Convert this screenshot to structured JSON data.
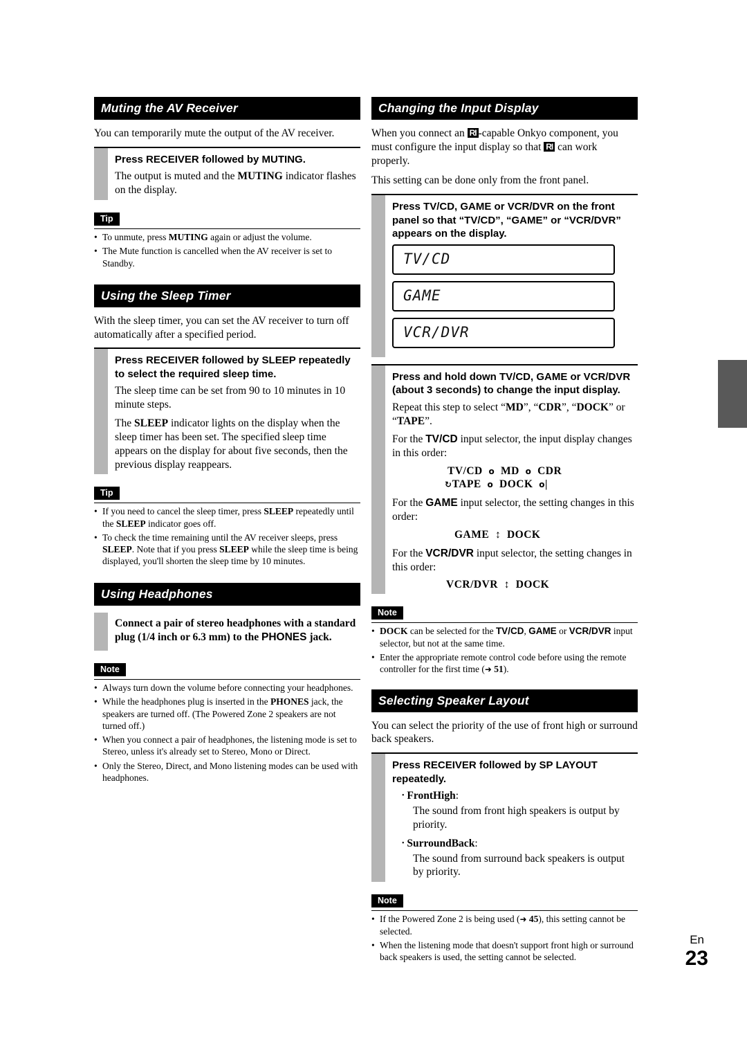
{
  "page": {
    "footer_lang": "En",
    "footer_number": "23"
  },
  "left": {
    "muting": {
      "heading": "Muting the AV Receiver",
      "intro": "You can temporarily mute the output of the AV receiver.",
      "step_title": "Press RECEIVER followed by MUTING.",
      "step_body": "The output is muted and the MUTING indicator flashes on the display.",
      "tip_label": "Tip",
      "tips": [
        "To unmute, press MUTING again or adjust the volume.",
        "The Mute function is cancelled when the AV receiver is set to Standby."
      ]
    },
    "sleep": {
      "heading": "Using the Sleep Timer",
      "intro": "With the sleep timer, you can set the AV receiver to turn off automatically after a specified period.",
      "step_title": "Press RECEIVER followed by SLEEP repeatedly to select the required sleep time.",
      "step_body_1": "The sleep time can be set from 90 to 10 minutes in 10 minute steps.",
      "step_body_2": "The SLEEP indicator lights on the display when the sleep timer has been set. The specified sleep time appears on the display for about five seconds, then the previous display reappears.",
      "tip_label": "Tip",
      "tips": [
        "If you need to cancel the sleep timer, press SLEEP repeatedly until the SLEEP indicator goes off.",
        "To check the time remaining until the AV receiver sleeps, press SLEEP. Note that if you press SLEEP while the sleep time is being displayed, you'll shorten the sleep time by 10 minutes."
      ]
    },
    "headphones": {
      "heading": "Using Headphones",
      "step_title": "Connect a pair of stereo headphones with a standard plug (1/4 inch or 6.3 mm) to the PHONES jack.",
      "note_label": "Note",
      "notes": [
        "Always turn down the volume before connecting your headphones.",
        "While the headphones plug is inserted in the PHONES jack, the speakers are turned off. (The Powered Zone 2 speakers are not turned off.)",
        "When you connect a pair of headphones, the listening mode is set to Stereo, unless it's already set to Stereo, Mono or Direct.",
        "Only the Stereo, Direct, and Mono listening modes can be used with headphones."
      ]
    }
  },
  "right": {
    "input_display": {
      "heading": "Changing the Input Display",
      "intro_1": "When you connect an RI-capable Onkyo component, you must configure the input display so that RI can work properly.",
      "intro_2": "This setting can be done only from the front panel.",
      "step1_title": "Press TV/CD, GAME or VCR/DVR on the front panel so that “TV/CD”, “GAME” or “VCR/DVR” appears on the display.",
      "panels": [
        "TV/CD",
        "GAME",
        "VCR/DVR"
      ],
      "step2_title": "Press and hold down TV/CD, GAME or VCR/DVR (about 3 seconds) to change the input display.",
      "step2_body_1": "Repeat this step to select “MD”, “CDR”, “DOCK” or “TAPE”.",
      "step2_body_2": "For the TV/CD input selector, the input display changes in this order:",
      "seq_tvcd_line1": "TV/CD      MD      CDR",
      "seq_tvcd_line2": "TAPE      DOCK",
      "step2_body_3": "For the GAME input selector, the setting changes in this order:",
      "seq_game": "GAME     DOCK",
      "step2_body_4": "For the VCR/DVR input selector, the setting changes in this order:",
      "seq_vcr": "VCR/DVR     DOCK",
      "note_label": "Note",
      "notes": [
        "DOCK can be selected for the TV/CD, GAME or VCR/DVR input selector, but not at the same time.",
        "Enter the appropriate remote control code before using the remote controller for the first time (→ 51)."
      ]
    },
    "speaker_layout": {
      "heading": "Selecting Speaker Layout",
      "intro": "You can select the priority of the use of front high or surround back speakers.",
      "step_title": "Press RECEIVER followed by SP LAYOUT repeatedly.",
      "option1_label": "FrontHigh",
      "option1_body": "The sound from front high speakers is output by priority.",
      "option2_label": "SurroundBack",
      "option2_body": "The sound from surround back speakers is output by priority.",
      "note_label": "Note",
      "notes": [
        "If the Powered Zone 2 is being used (→ 45), this setting cannot be selected.",
        "When the listening mode that doesn't support front high or surround back speakers is used, the setting cannot be selected."
      ]
    }
  }
}
